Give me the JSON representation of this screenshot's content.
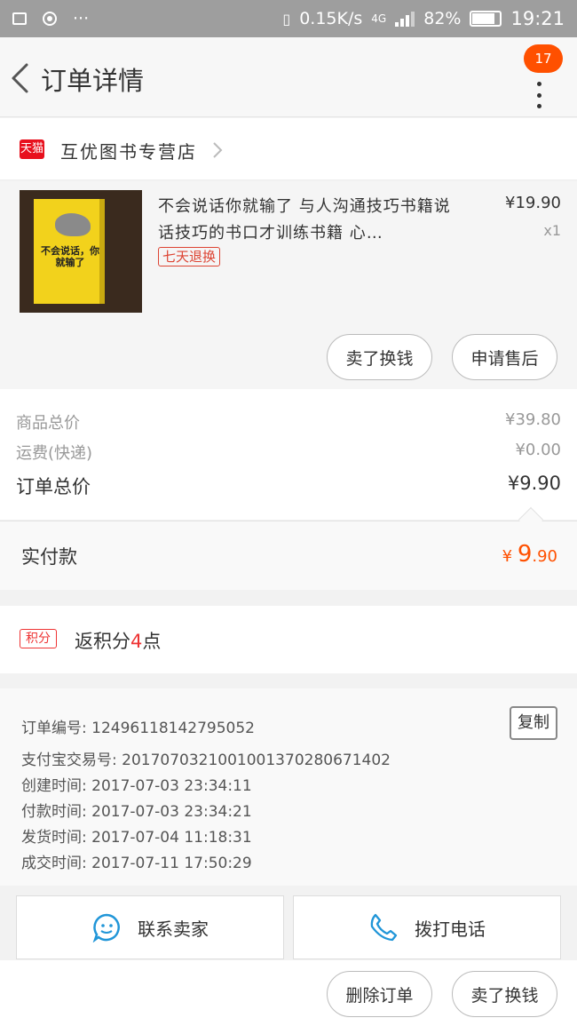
{
  "status": {
    "speed": "0.15K/s",
    "net": "4G",
    "battery": "82%",
    "battery_level": 0.82,
    "time": "19:21",
    "dots": "···"
  },
  "header": {
    "title": "订单详情",
    "badge": "17"
  },
  "store": {
    "tag": "天猫",
    "name": "互优图书专营店"
  },
  "item": {
    "title": "不会说话你就输了 与人沟通技巧书籍说话技巧的书口才训练书籍 心…",
    "price": "¥19.90",
    "qty": "x1",
    "tag": "七天退换",
    "cover_text": "不会说话，你就输了",
    "actions": [
      "卖了换钱",
      "申请售后"
    ]
  },
  "summary": {
    "goods_label": "商品总价",
    "goods_value": "¥39.80",
    "shipping_label": "运费(快递)",
    "shipping_value": "¥0.00",
    "total_label": "订单总价",
    "total_value": "¥9.90"
  },
  "paid": {
    "label": "实付款",
    "currency": "¥",
    "int": "9",
    "dec": ".90"
  },
  "points": {
    "tag": "积分",
    "prefix": "返积分",
    "num": "4",
    "suffix": "点"
  },
  "info": {
    "copy": "复制",
    "lines": [
      "订单编号: 12496118142795052",
      "支付宝交易号: 2017070321001001370280671402",
      "创建时间: 2017-07-03 23:34:11",
      "付款时间: 2017-07-03 23:34:21",
      "发货时间: 2017-07-04 11:18:31",
      "成交时间: 2017-07-11 17:50:29"
    ]
  },
  "contact": {
    "seller": "联系卖家",
    "phone": "拨打电话"
  },
  "footer": {
    "delete": "删除订单",
    "sell": "卖了换钱"
  },
  "colors": {
    "accent": "#ff5000",
    "tmall": "#e8101d",
    "icon_blue": "#2196d8"
  }
}
